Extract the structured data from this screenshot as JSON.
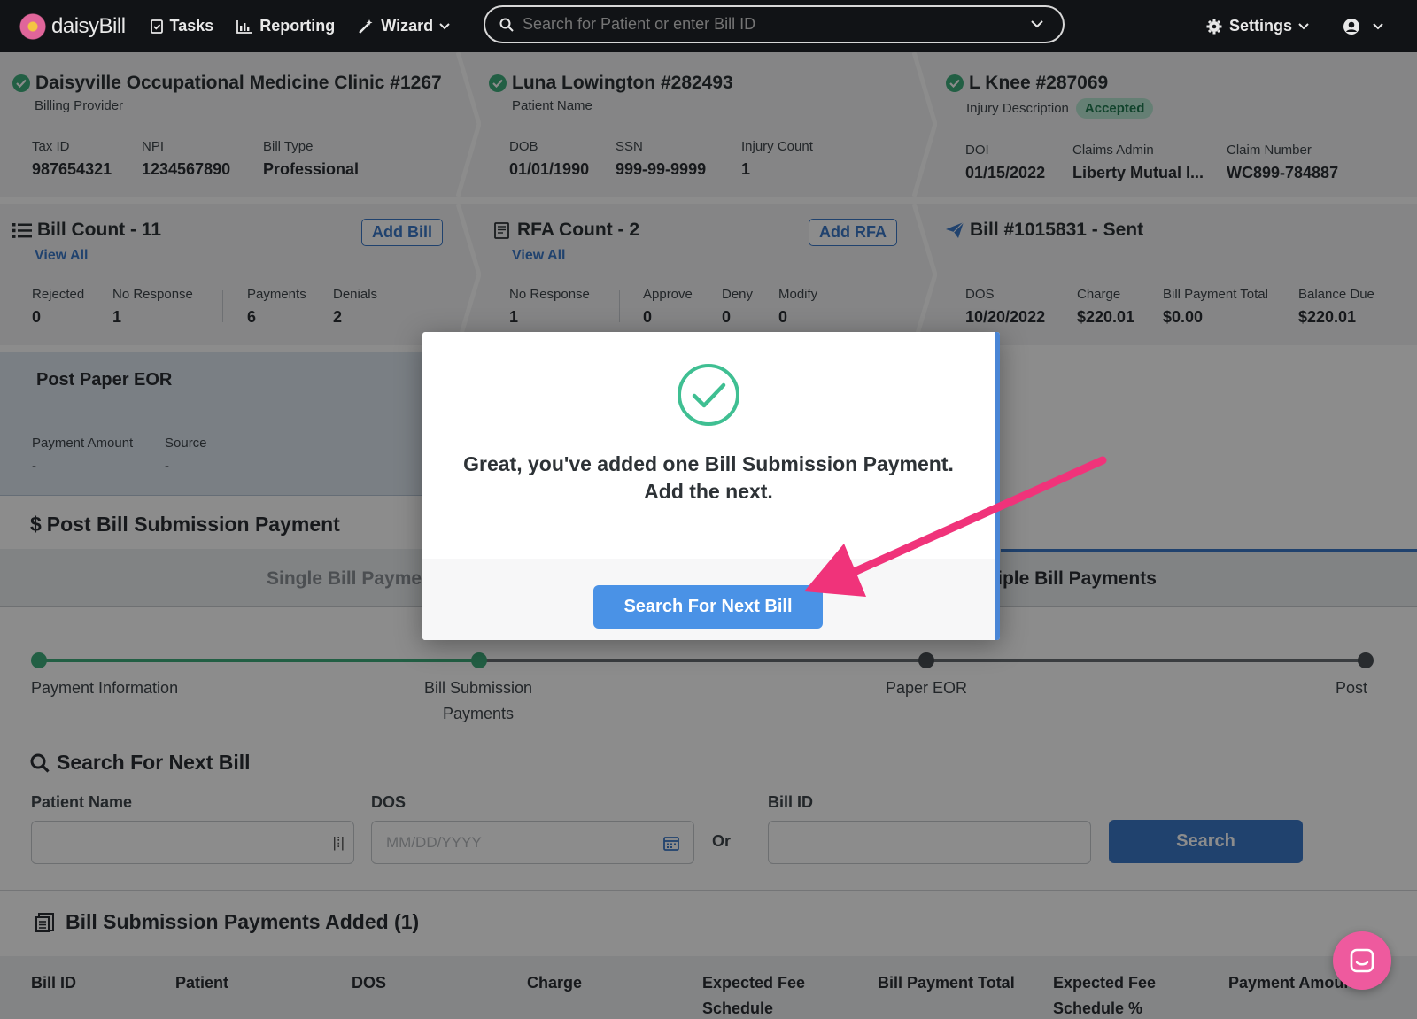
{
  "nav": {
    "logo_text": "daisyBill",
    "tasks": "Tasks",
    "reporting": "Reporting",
    "wizard": "Wizard",
    "search_placeholder": "Search for Patient or enter Bill ID",
    "settings": "Settings"
  },
  "provider": {
    "name": "Daisyville Occupational Medicine Clinic #1267",
    "role": "Billing Provider",
    "tax_id_label": "Tax ID",
    "tax_id": "987654321",
    "npi_label": "NPI",
    "npi": "1234567890",
    "bill_type_label": "Bill Type",
    "bill_type": "Professional"
  },
  "patient": {
    "name": "Luna Lowington #282493",
    "role": "Patient Name",
    "dob_label": "DOB",
    "dob": "01/01/1990",
    "ssn_label": "SSN",
    "ssn": "999-99-9999",
    "injury_count_label": "Injury Count",
    "injury_count": "1"
  },
  "injury": {
    "name": "L Knee #287069",
    "role": "Injury Description",
    "status": "Accepted",
    "doi_label": "DOI",
    "doi": "01/15/2022",
    "claims_admin_label": "Claims Admin",
    "claims_admin": "Liberty Mutual I...",
    "claim_number_label": "Claim Number",
    "claim_number": "WC899-784887"
  },
  "bills": {
    "title": "Bill Count - 11",
    "view_all": "View All",
    "add_button": "Add Bill",
    "rejected_label": "Rejected",
    "rejected": "0",
    "no_response_label": "No Response",
    "no_response": "1",
    "payments_label": "Payments",
    "payments": "6",
    "denials_label": "Denials",
    "denials": "2"
  },
  "rfa": {
    "title": "RFA Count - 2",
    "view_all": "View All",
    "add_button": "Add RFA",
    "no_response_label": "No Response",
    "no_response": "1",
    "approve_label": "Approve",
    "approve": "0",
    "deny_label": "Deny",
    "deny": "0",
    "modify_label": "Modify",
    "modify": "0"
  },
  "bill": {
    "title": "Bill #1015831 - Sent",
    "dos_label": "DOS",
    "dos": "10/20/2022",
    "charge_label": "Charge",
    "charge": "$220.01",
    "payment_total_label": "Bill Payment Total",
    "payment_total": "$0.00",
    "balance_label": "Balance Due",
    "balance": "$220.01"
  },
  "post_eor": {
    "title": "Post Paper EOR",
    "amount_label": "Payment Amount",
    "amount": "-",
    "source_label": "Source",
    "source": "-"
  },
  "payment_section": {
    "title": "Post Bill Submission Payment",
    "tab_single": "Single Bill Payments",
    "tab_multiple": "Multiple Bill Payments"
  },
  "stepper": {
    "steps": [
      "Payment Information",
      "Bill Submission Payments",
      "Paper EOR",
      "Post"
    ]
  },
  "search_next": {
    "title": "Search For Next Bill",
    "patient_label": "Patient Name",
    "dos_label": "DOS",
    "dos_placeholder": "MM/DD/YYYY",
    "or": "Or",
    "bill_id_label": "Bill ID",
    "search_button": "Search"
  },
  "added": {
    "title": "Bill Submission Payments Added (1)",
    "columns": [
      "Bill ID",
      "Patient",
      "DOS",
      "Charge",
      "Expected Fee Schedule",
      "Bill Payment Total",
      "Expected Fee Schedule %",
      "Payment Amount"
    ]
  },
  "modal": {
    "message_line1": "Great, you've added one Bill Submission Payment.",
    "message_line2": "Add the next.",
    "button": "Search For Next Bill"
  },
  "colors": {
    "accent": "#3b79c9",
    "success": "#3fae7c",
    "arrow": "#f0337a",
    "chat": "#ee5a9e"
  }
}
